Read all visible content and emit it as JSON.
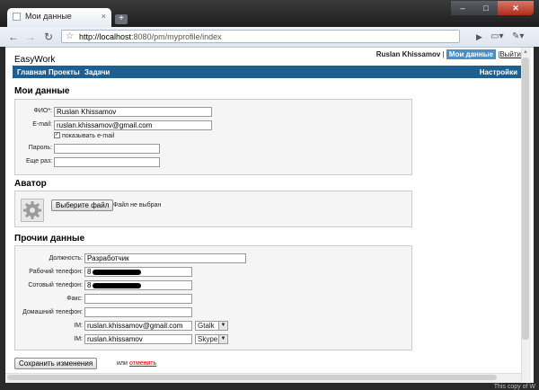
{
  "browser": {
    "tab_title": "Мои данные",
    "url_host": "http://localhost",
    "url_path": ":8080/pm/myprofile/index"
  },
  "header": {
    "app_title": "EasyWork",
    "username": "Ruslan Khissamov",
    "separator": "|",
    "profile_link": "Мои данные",
    "logout_link": "Выйти"
  },
  "nav": {
    "items": [
      "Главная",
      "Проекты",
      "Задачи"
    ],
    "settings": "Настройки"
  },
  "my_data": {
    "title": "Мои данные",
    "fio_label": "ФИО*:",
    "fio_value": "Ruslan Khissamov",
    "email_label": "E-mail:",
    "email_value": "ruslan.khissamov@gmail.com",
    "show_email_label": "показывать e-mail",
    "password_label": "Пароль:",
    "password_again_label": "Еще раз:"
  },
  "avatar": {
    "title": "Аватор",
    "choose_file_button": "Выберите файл",
    "no_file_text": "Файл не выбран"
  },
  "other": {
    "title": "Прочии данные",
    "position_label": "Должность:",
    "position_value": "Разработчик",
    "work_phone_label": "Рабочий телефон:",
    "work_phone_prefix": "8",
    "mobile_phone_label": "Сотовый телефон:",
    "mobile_phone_prefix": "8",
    "fax_label": "Факс:",
    "home_phone_label": "Домашний телефон:",
    "im_label": "IM:",
    "im1_value": "ruslan.khissamov@gmail.com",
    "im1_type": "Gtalk",
    "im2_value": "ruslan.khissamov",
    "im2_type": "Skype"
  },
  "footer": {
    "save_button": "Сохранить изменения",
    "or_text": "или",
    "cancel_link": "отменить"
  },
  "watermark": "This copy of W"
}
